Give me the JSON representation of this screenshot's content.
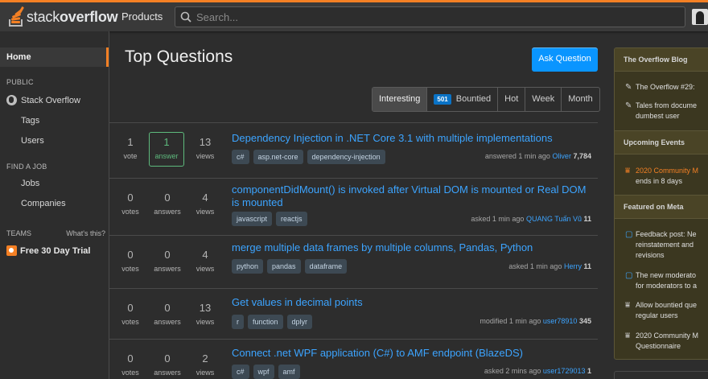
{
  "header": {
    "logo_light": "stack",
    "logo_bold": "overflow",
    "products": "Products",
    "search_placeholder": "Search..."
  },
  "leftnav": {
    "home": "Home",
    "public_label": "PUBLIC",
    "stack_overflow": "Stack Overflow",
    "tags": "Tags",
    "users": "Users",
    "find_job_label": "FIND A JOB",
    "jobs": "Jobs",
    "companies": "Companies",
    "teams_label": "TEAMS",
    "whats_this": "What's this?",
    "free_trial": "Free 30 Day Trial"
  },
  "main": {
    "title": "Top Questions",
    "ask_button": "Ask Question",
    "filters": {
      "interesting": "Interesting",
      "bountied_count": "501",
      "bountied": "Bountied",
      "hot": "Hot",
      "week": "Week",
      "month": "Month"
    },
    "questions": [
      {
        "votes": "1",
        "votes_label": "vote",
        "answers": "1",
        "answers_label": "answer",
        "views": "13",
        "views_label": "views",
        "title": "Dependency Injection in .NET Core 3.1 with multiple implementations",
        "tags": [
          "c#",
          "asp.net-core",
          "dependency-injection"
        ],
        "action": "answered 1 min ago",
        "user": "Oliver",
        "rep": "7,784"
      },
      {
        "votes": "0",
        "votes_label": "votes",
        "answers": "0",
        "answers_label": "answers",
        "views": "4",
        "views_label": "views",
        "title": "componentDidMount() is invoked after Virtual DOM is mounted or Real DOM is mounted",
        "tags": [
          "javascript",
          "reactjs"
        ],
        "action": "asked 1 min ago",
        "user": "QUANG Tuấn Vũ",
        "rep": "11"
      },
      {
        "votes": "0",
        "votes_label": "votes",
        "answers": "0",
        "answers_label": "answers",
        "views": "4",
        "views_label": "views",
        "title": "merge multiple data frames by multiple columns, Pandas, Python",
        "tags": [
          "python",
          "pandas",
          "dataframe"
        ],
        "action": "asked 1 min ago",
        "user": "Herry",
        "rep": "11"
      },
      {
        "votes": "0",
        "votes_label": "votes",
        "answers": "0",
        "answers_label": "answers",
        "views": "13",
        "views_label": "views",
        "title": "Get values in decimal points",
        "tags": [
          "r",
          "function",
          "dplyr"
        ],
        "action": "modified 1 min ago",
        "user": "user78910",
        "rep": "345"
      },
      {
        "votes": "0",
        "votes_label": "votes",
        "answers": "0",
        "answers_label": "answers",
        "views": "2",
        "views_label": "views",
        "title": "Connect .net WPF application (C#) to AMF endpoint (BlazeDS)",
        "tags": [
          "c#",
          "wpf",
          "amf"
        ],
        "action": "asked 2 mins ago",
        "user": "user1729013",
        "rep": "1"
      }
    ]
  },
  "sidebar": {
    "blog_header": "The Overflow Blog",
    "blog_items": [
      "The Overflow #29:",
      "Tales from docume",
      "dumbest user"
    ],
    "events_header": "Upcoming Events",
    "event_title": "2020 Community M",
    "event_sub": "ends in 8 days",
    "meta_header": "Featured on Meta",
    "meta_items": [
      [
        "Feedback post: Ne",
        "reinstatement and",
        "revisions"
      ],
      [
        "The new moderato",
        "for moderators to a"
      ],
      [
        "Allow bountied que",
        "regular users"
      ],
      [
        "2020 Community M",
        "Questionnaire"
      ]
    ]
  },
  "colors": {
    "accent": "#f48024",
    "link": "#3ca4ff",
    "answered": "#5eba7d",
    "button": "#0a95ff"
  }
}
